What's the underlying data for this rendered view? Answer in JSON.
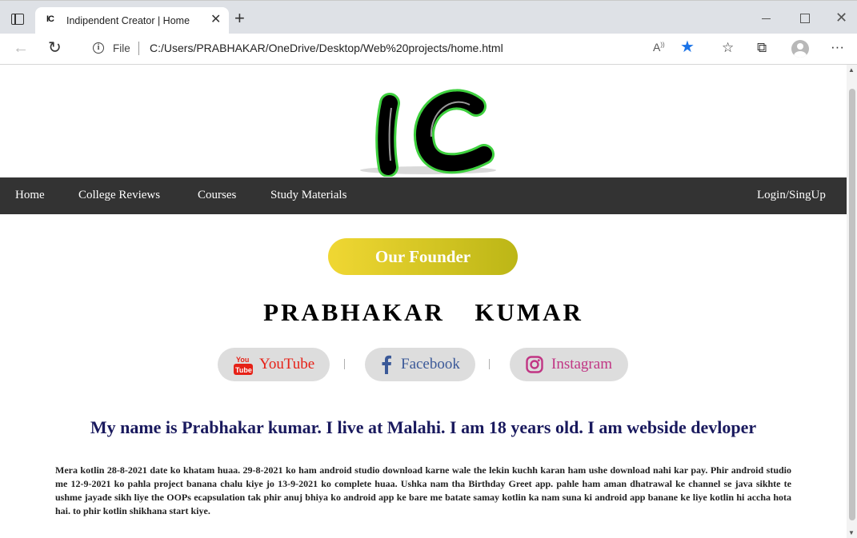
{
  "browser": {
    "tab_favicon": "IC",
    "tab_title": "Indipendent Creator | Home",
    "address_scheme": "File",
    "address_url": "C:/Users/PRABHAKAR/OneDrive/Desktop/Web%20projects/home.html",
    "icons": [
      "tab-actions-icon",
      "close-icon",
      "new-tab-icon",
      "back-icon",
      "reload-icon",
      "info-icon",
      "read-aloud-icon",
      "favorite-star-icon",
      "favorites-icon",
      "collections-icon",
      "profile-avatar",
      "more-icon",
      "minimize-icon",
      "maximize-icon",
      "window-close-icon"
    ],
    "accent_color": "#1a73e8"
  },
  "page": {
    "logo_text": "IC",
    "nav": {
      "items": [
        {
          "label": "Home"
        },
        {
          "label": "College Reviews"
        },
        {
          "label": "Courses"
        },
        {
          "label": "Study Materials"
        }
      ],
      "login_label": "Login/SingUp",
      "background": "#333333"
    },
    "founder_button": "Our Founder",
    "founder_name": "PRABHAKAR  KUMAR",
    "socials": [
      {
        "label": "YouTube",
        "color": "#e62117",
        "icon": "youtube-icon"
      },
      {
        "label": "Facebook",
        "color": "#3b5998",
        "icon": "facebook-icon"
      },
      {
        "label": "Instagram",
        "color": "#c13584",
        "icon": "instagram-icon"
      }
    ],
    "separator": "|",
    "intro": "My name is Prabhakar kumar. I live at Malahi. I am 18 years old. I am webside devloper",
    "paragraph": "Mera kotlin 28-8-2021 date ko khatam huaa. 29-8-2021 ko ham android studio download karne wale the lekin kuchh karan ham ushe download nahi kar pay. Phir android studio me 12-9-2021 ko pahla project banana chalu kiye jo 13-9-2021 ko complete huaa. Ushka nam tha Birthday Greet app. pahle ham aman dhatrawal ke channel se java sikhte te ushme jayade sikh liye the OOPs ecapsulation tak phir anuj bhiya ko android app ke bare me batate samay kotlin ka nam suna ki android app banane ke liye kotlin hi accha hota hai. to phir kotlin shikhana start kiye."
  }
}
